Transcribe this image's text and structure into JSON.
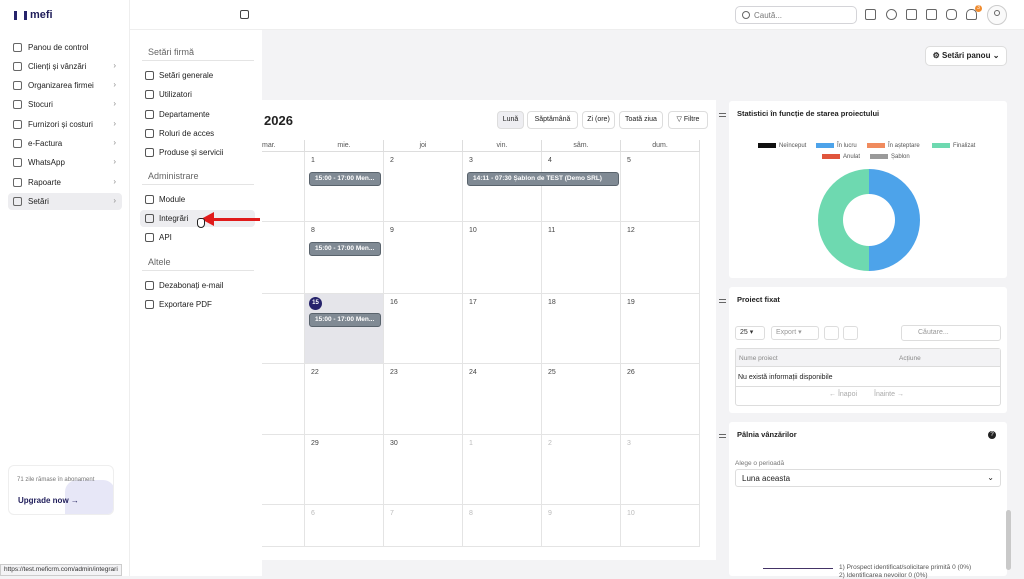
{
  "brand": {
    "name": "mefi"
  },
  "topbar": {
    "search_placeholder": "Caută..."
  },
  "notifications": {
    "badge": "3"
  },
  "sidebar": {
    "items": [
      {
        "label": "Panou de control",
        "icon": "home-icon",
        "chevron": false
      },
      {
        "label": "Clienți și vânzări",
        "icon": "users-icon",
        "chevron": true
      },
      {
        "label": "Organizarea firmei",
        "icon": "sitemap-icon",
        "chevron": true
      },
      {
        "label": "Stocuri",
        "icon": "box-icon",
        "chevron": true
      },
      {
        "label": "Furnizori și costuri",
        "icon": "truck-icon",
        "chevron": true
      },
      {
        "label": "e-Factura",
        "icon": "paper-plane-icon",
        "chevron": true
      },
      {
        "label": "WhatsApp",
        "icon": "whatsapp-icon",
        "chevron": true
      },
      {
        "label": "Rapoarte",
        "icon": "chart-icon",
        "chevron": true
      },
      {
        "label": "Setări",
        "icon": "gear-icon",
        "chevron": true,
        "active": true
      }
    ],
    "promo": {
      "message": "71 zile rămase în abonament",
      "upgrade_label": "Upgrade now"
    }
  },
  "submenu": {
    "sections": [
      {
        "title": "Setări firmă",
        "items": [
          "Setări generale",
          "Utilizatori",
          "Departamente",
          "Roluri de acces",
          "Produse și servicii"
        ]
      },
      {
        "title": "Administrare",
        "items": [
          "Module",
          "Integrări",
          "API"
        ]
      },
      {
        "title": "Altele",
        "items": [
          "Dezabonați e-mail",
          "Exportare PDF"
        ]
      }
    ],
    "highlighted": "Integrări"
  },
  "dashboard": {
    "settings_button": "Setări panou"
  },
  "calendar": {
    "title": "2026",
    "views": [
      "Lună",
      "Săptămână",
      "Zi (ore)",
      "Toată ziua"
    ],
    "active_view": "Lună",
    "filters_label": "Filtre",
    "weekdays": [
      "mar.",
      "mie.",
      "joi",
      "vin.",
      "sâm.",
      "dum."
    ],
    "weeks": [
      [
        "",
        "1",
        "2",
        "3",
        "4",
        "5"
      ],
      [
        "",
        "8",
        "9",
        "10",
        "11",
        "12"
      ],
      [
        "",
        "15",
        "16",
        "17",
        "18",
        "19"
      ],
      [
        "",
        "22",
        "23",
        "24",
        "25",
        "26"
      ],
      [
        "",
        "29",
        "30",
        "1",
        "2",
        "3"
      ],
      [
        "",
        "6",
        "7",
        "8",
        "9",
        "10"
      ]
    ],
    "today": "15",
    "events": [
      {
        "text": "15:00 - 17:00 Men..."
      },
      {
        "text": "14:11 - 07:30 Șablon de TEST (Demo SRL)"
      },
      {
        "text": "15:00 - 17:00 Men..."
      },
      {
        "text": "15:00 - 17:00 Men..."
      }
    ]
  },
  "stats": {
    "title": "Statistici în funcție de starea proiectului",
    "legend": [
      {
        "label": "Neînceput",
        "color": "#111111"
      },
      {
        "label": "În lucru",
        "color": "#4da3ea"
      },
      {
        "label": "În așteptare",
        "color": "#f08b5e"
      },
      {
        "label": "Finalizat",
        "color": "#6ed9b0"
      },
      {
        "label": "Anulat",
        "color": "#e0553c"
      },
      {
        "label": "Șablon",
        "color": "#9a9a9a"
      }
    ]
  },
  "chart_data": {
    "type": "pie",
    "categories": [
      "În lucru",
      "Finalizat"
    ],
    "values": [
      50,
      50
    ],
    "colors": [
      "#4da3ea",
      "#6ed9b0"
    ]
  },
  "projects": {
    "title": "Proiect fixat",
    "page_size": "25",
    "export_label": "Export",
    "search_placeholder": "Căutare...",
    "columns": [
      "Nume proiect",
      "Acțiune"
    ],
    "empty": "Nu există informații disponibile",
    "prev": "Înapoi",
    "next": "Înainte"
  },
  "funnel": {
    "title": "Pâlnia vânzărilor",
    "period_label": "Alege o perioadă",
    "period_value": "Luna aceasta",
    "stage1": "1) Prospect identificat/solicitare primită 0 (0%)",
    "stage2": "2) Identificarea nevoilor 0 (0%)"
  },
  "status_bar": {
    "url": "https://test.meficrm.com/admin/integrari"
  }
}
